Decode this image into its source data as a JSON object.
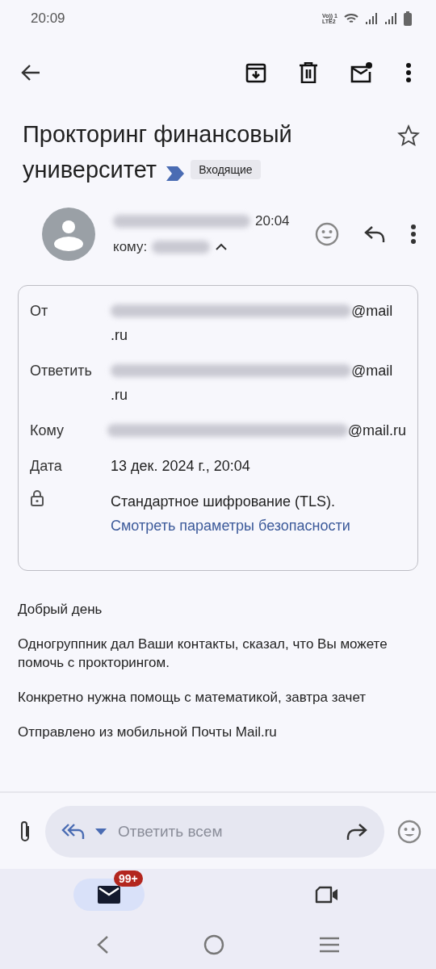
{
  "status_bar": {
    "time": "20:09",
    "network_lines": [
      "Vo)) 1",
      "LTE2"
    ]
  },
  "subject": {
    "title_lines": [
      "Прокторинг финансовый",
      "университет"
    ],
    "label": "Входящие",
    "starred": false
  },
  "sender": {
    "name_redacted": true,
    "time": "20:04",
    "to_label": "кому:",
    "to_redacted": true,
    "expanded": true
  },
  "details": [
    {
      "kind": "text",
      "label": "От",
      "redacted": true,
      "lines": [
        "@mail",
        ".ru"
      ]
    },
    {
      "kind": "text",
      "label": "Ответить",
      "redacted": true,
      "lines": [
        "@mail",
        ".ru"
      ]
    },
    {
      "kind": "text",
      "label": "Кому",
      "redacted": true,
      "lines": [
        "@mail.ru"
      ]
    },
    {
      "kind": "text",
      "label": "Дата",
      "redacted": false,
      "lines": [
        "13 дек. 2024 г., 20:04"
      ]
    },
    {
      "kind": "security",
      "lines": [
        "Стандартное шифрование (TLS)."
      ],
      "link": "Смотреть параметры безопасности"
    }
  ],
  "body": [
    "Добрый день",
    "Одногруппник дал Ваши контакты, сказал, что Вы можете помочь с прокторингом.",
    "Конкретно нужна помощь с математикой, завтра зачет",
    "Отправлено из мобильной Почты Mail.ru"
  ],
  "compose": {
    "placeholder": "Ответить всем"
  },
  "bottom_nav": [
    {
      "kind": "mail",
      "selected": true,
      "badge": "99+"
    },
    {
      "kind": "meet",
      "selected": false
    }
  ]
}
